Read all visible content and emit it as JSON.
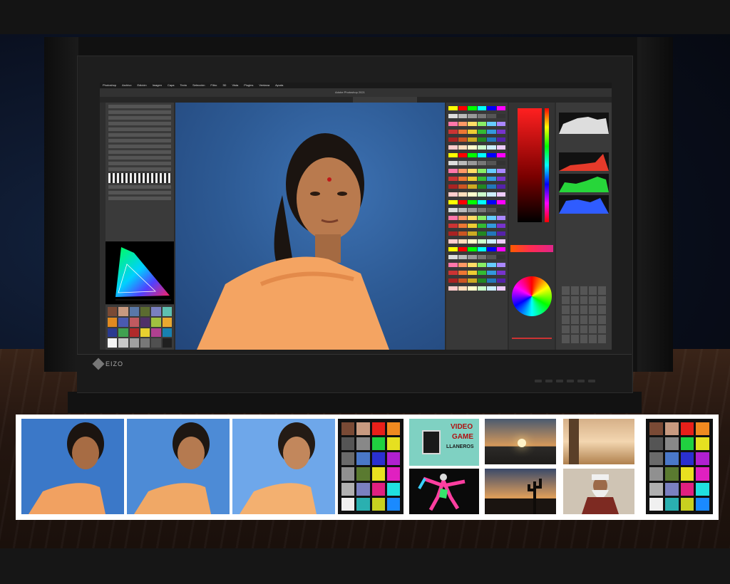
{
  "scene": {
    "monitor_brand": "EIZO",
    "app_title": "Adobe Photoshop 2021",
    "menu": [
      "Photoshop",
      "Archivo",
      "Edición",
      "Imagen",
      "Capa",
      "Texto",
      "Selección",
      "Filtro",
      "3D",
      "Vista",
      "Plugins",
      "Ventana",
      "Ayuda"
    ]
  },
  "thumbnails": {
    "video_game_sign": [
      "VIDEO",
      "GAME",
      "LLANEROS"
    ]
  },
  "colors": {
    "background": "#0a0c12",
    "accent_blue": "#3b78c8",
    "shirt_orange": "#f4a462"
  }
}
